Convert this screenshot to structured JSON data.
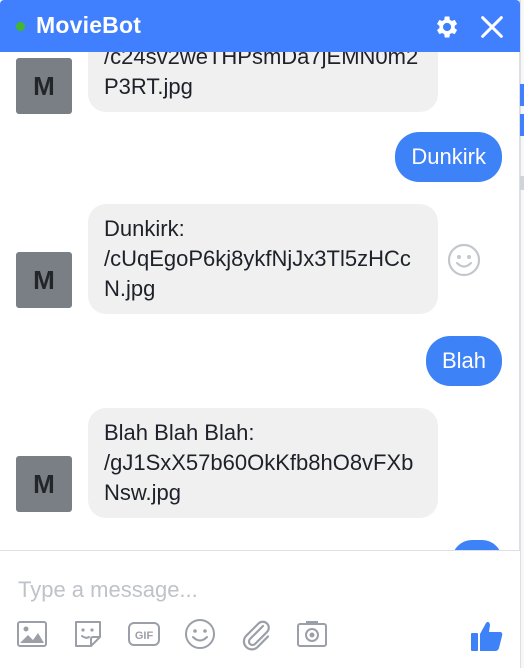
{
  "header": {
    "title": "MovieBot",
    "status": "online"
  },
  "colors": {
    "accent": "#4080ff",
    "user_bubble": "#3e82f7",
    "bot_bubble": "#f1f0f0",
    "online_dot": "#42b72a"
  },
  "messages": [
    {
      "sender": "bot",
      "avatar_letter": "M",
      "text": "/c24sv2weTHPsmDa7jEMN0m2P3RT.jpg"
    },
    {
      "sender": "user",
      "text": "Dunkirk"
    },
    {
      "sender": "bot",
      "avatar_letter": "M",
      "text": "Dunkirk:\n/cUqEgoP6kj8ykfNjJx3Tl5zHCcN.jpg"
    },
    {
      "sender": "user",
      "text": "Blah"
    },
    {
      "sender": "bot",
      "avatar_letter": "M",
      "text": "Blah Blah Blah:\n/gJ1SxX57b60OkKfb8hO8vFXbNsw.jpg"
    }
  ],
  "composer": {
    "placeholder": "Type a message...",
    "tools": [
      "image-icon",
      "sticker-icon",
      "gif-icon",
      "emoji-icon",
      "attachment-icon",
      "camera-icon"
    ],
    "gif_label": "GIF"
  }
}
